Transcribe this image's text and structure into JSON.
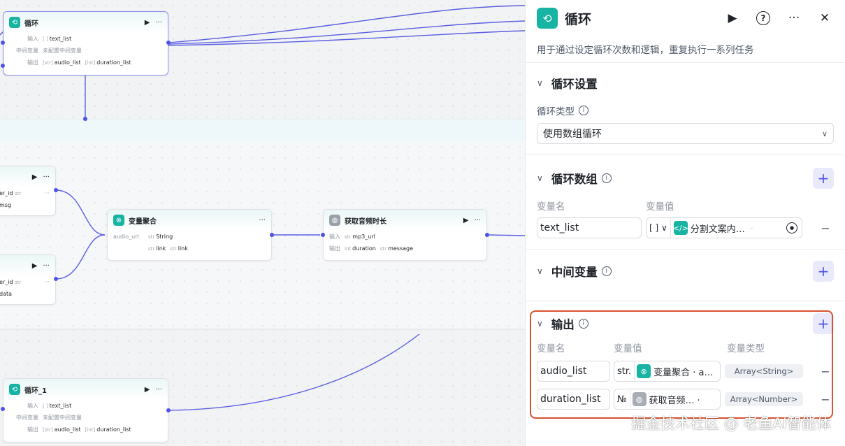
{
  "canvas": {
    "loop_top": {
      "title": "循环",
      "rows": [
        {
          "label": "输入",
          "tags": [
            {
              "t": "[ ]",
              "v": "text_list"
            }
          ]
        },
        {
          "label": "中间变量",
          "text": "未配置中间变量"
        },
        {
          "label": "输出",
          "tags": [
            {
              "t": "[str]",
              "v": "audio_list"
            },
            {
              "t": "[int]",
              "v": "duration_list"
            }
          ]
        }
      ]
    },
    "left_node_a": {
      "rows": [
        {
          "v": "er_id",
          "t": "str"
        },
        {
          "v": "msg"
        }
      ]
    },
    "left_node_b": {
      "rows": [
        {
          "v": "er_id",
          "t": "str"
        },
        {
          "v": "data"
        }
      ]
    },
    "var_agg": {
      "title": "变量聚合",
      "label": "audio_url",
      "tag1": {
        "t": "str",
        "v": "String"
      },
      "tag2": {
        "t": "str",
        "v": "link"
      },
      "tag3": {
        "t": "str",
        "v": "link"
      }
    },
    "audio_dur": {
      "title": "获取音频时长",
      "in_label": "输入",
      "in_tag": {
        "t": "str",
        "v": "mp3_url"
      },
      "out_label": "输出",
      "out_tags": [
        {
          "t": "int",
          "v": "duration"
        },
        {
          "t": "str",
          "v": "message"
        }
      ]
    },
    "loop_bottom": {
      "title": "循环_1",
      "rows": [
        {
          "label": "输入",
          "tags": [
            {
              "t": "[ ]",
              "v": "text_list"
            }
          ]
        },
        {
          "label": "中间变量",
          "text": "未配置中间变量"
        },
        {
          "label": "输出",
          "tags": [
            {
              "t": "[str]",
              "v": "audio_list"
            },
            {
              "t": "[int]",
              "v": "duration_list"
            }
          ]
        }
      ]
    }
  },
  "panel": {
    "title": "循环",
    "description": "用于通过设定循环次数和逻辑，重复执行一系列任务",
    "loop_settings": {
      "title": "循环设置",
      "type_label": "循环类型",
      "type_value": "使用数组循环"
    },
    "loop_array": {
      "title": "循环数组",
      "col_name": "变量名",
      "col_value": "变量值",
      "var_name": "text_list",
      "type_glyph": "[ ]",
      "ref_text": "分割文案内…",
      "ref_suffix": "-"
    },
    "mid_vars": {
      "title": "中间变量"
    },
    "output": {
      "title": "输出",
      "col_name": "变量名",
      "col_value": "变量值",
      "col_type": "变量类型",
      "rows": [
        {
          "name": "audio_list",
          "type_glyph": "str.",
          "ref": "变量聚合 · a…",
          "var_type": "Array<String>"
        },
        {
          "name": "duration_list",
          "type_glyph": "№",
          "ref": "获取音频… ·",
          "var_type": "Array<Number>"
        }
      ]
    }
  },
  "watermark": "掘金技术社区 @ 老鱼AI智能体",
  "colors": {
    "accent": "#4d53e8",
    "brand": "#17b3a3",
    "highlight": "#d9532f"
  }
}
